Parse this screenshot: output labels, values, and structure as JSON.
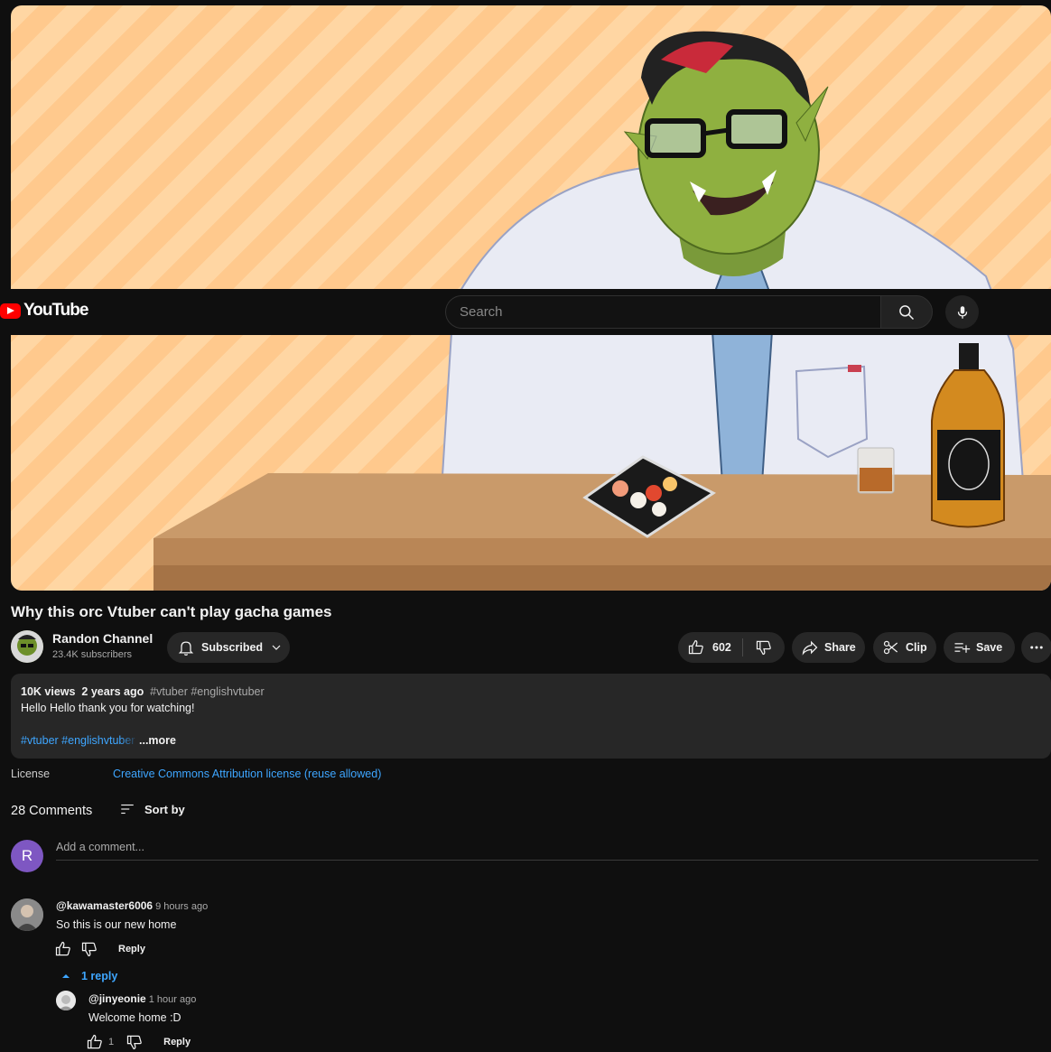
{
  "masthead": {
    "logo_text": "YouTube",
    "search_placeholder": "Search"
  },
  "video": {
    "title": "Why this orc Vtuber can't play gacha games"
  },
  "channel": {
    "name": "Randon Channel",
    "subscribers": "23.4K subscribers",
    "subscribed_label": "Subscribed"
  },
  "actions": {
    "like_count": "602",
    "share_label": "Share",
    "clip_label": "Clip",
    "save_label": "Save"
  },
  "description": {
    "views": "10K views",
    "age": "2 years ago",
    "tags": "#vtuber #englishvtuber",
    "text": "Hello Hello thank you for watching!",
    "hashtags": "#vtuber #englishvtuber",
    "more_label": "...more"
  },
  "license": {
    "label": "License",
    "value": "Creative Commons Attribution license (reuse allowed)"
  },
  "comments": {
    "count_label": "28 Comments",
    "sort_label": "Sort by",
    "my_avatar_letter": "R",
    "add_placeholder": "Add a comment...",
    "items": [
      {
        "author": "@kawamaster6006",
        "time": "9 hours ago",
        "text": "So this is our new home",
        "reply_label": "Reply",
        "replies_toggle": "1 reply"
      }
    ],
    "replies": [
      {
        "author": "@jinyeonie",
        "time": "1 hour ago",
        "text": "Welcome home :D",
        "likes": "1",
        "reply_label": "Reply"
      }
    ]
  },
  "colors": {
    "background": "#0f0f0f",
    "link": "#3ea6ff",
    "pill": "#272727",
    "brand_red": "#ff0000",
    "my_avatar": "#7e57c2"
  }
}
